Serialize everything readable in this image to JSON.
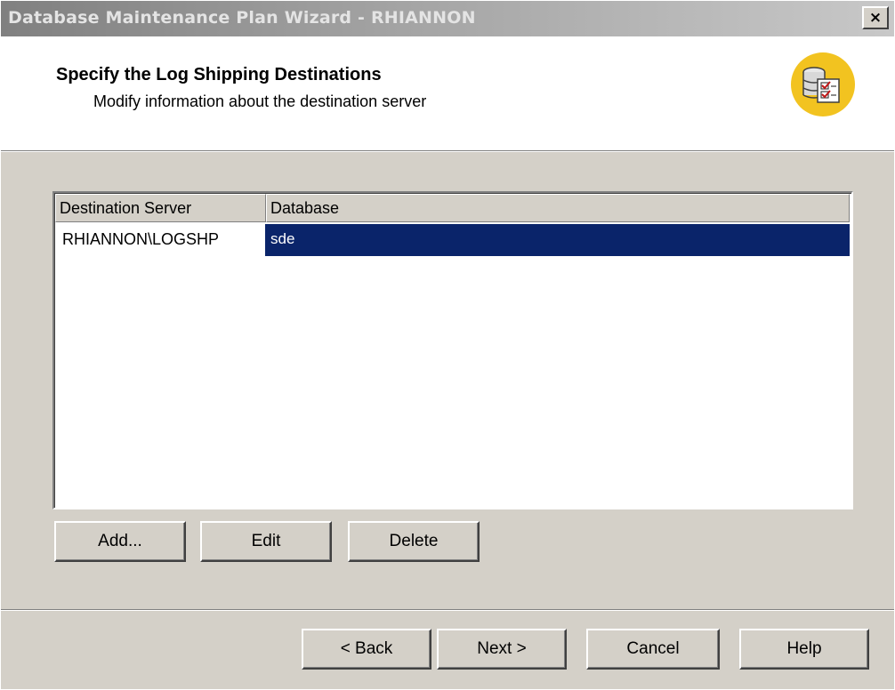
{
  "window": {
    "title": "Database Maintenance Plan Wizard - RHIANNON",
    "close_label": "×"
  },
  "header": {
    "title": "Specify the Log Shipping Destinations",
    "subtitle": "Modify information about the destination server",
    "icon": "database-checklist-icon"
  },
  "list": {
    "columns": [
      "Destination Server",
      "Database"
    ],
    "rows": [
      {
        "server": "RHIANNON\\LOGSHP",
        "database": "sde",
        "selected": true
      }
    ]
  },
  "list_buttons": {
    "add": "Add...",
    "edit": "Edit",
    "delete": "Delete"
  },
  "nav_buttons": {
    "back": "< Back",
    "next": "Next >",
    "cancel": "Cancel",
    "help": "Help"
  },
  "colors": {
    "face": "#d4d0c8",
    "selection": "#0a246a",
    "icon_bg": "#f2c320"
  }
}
